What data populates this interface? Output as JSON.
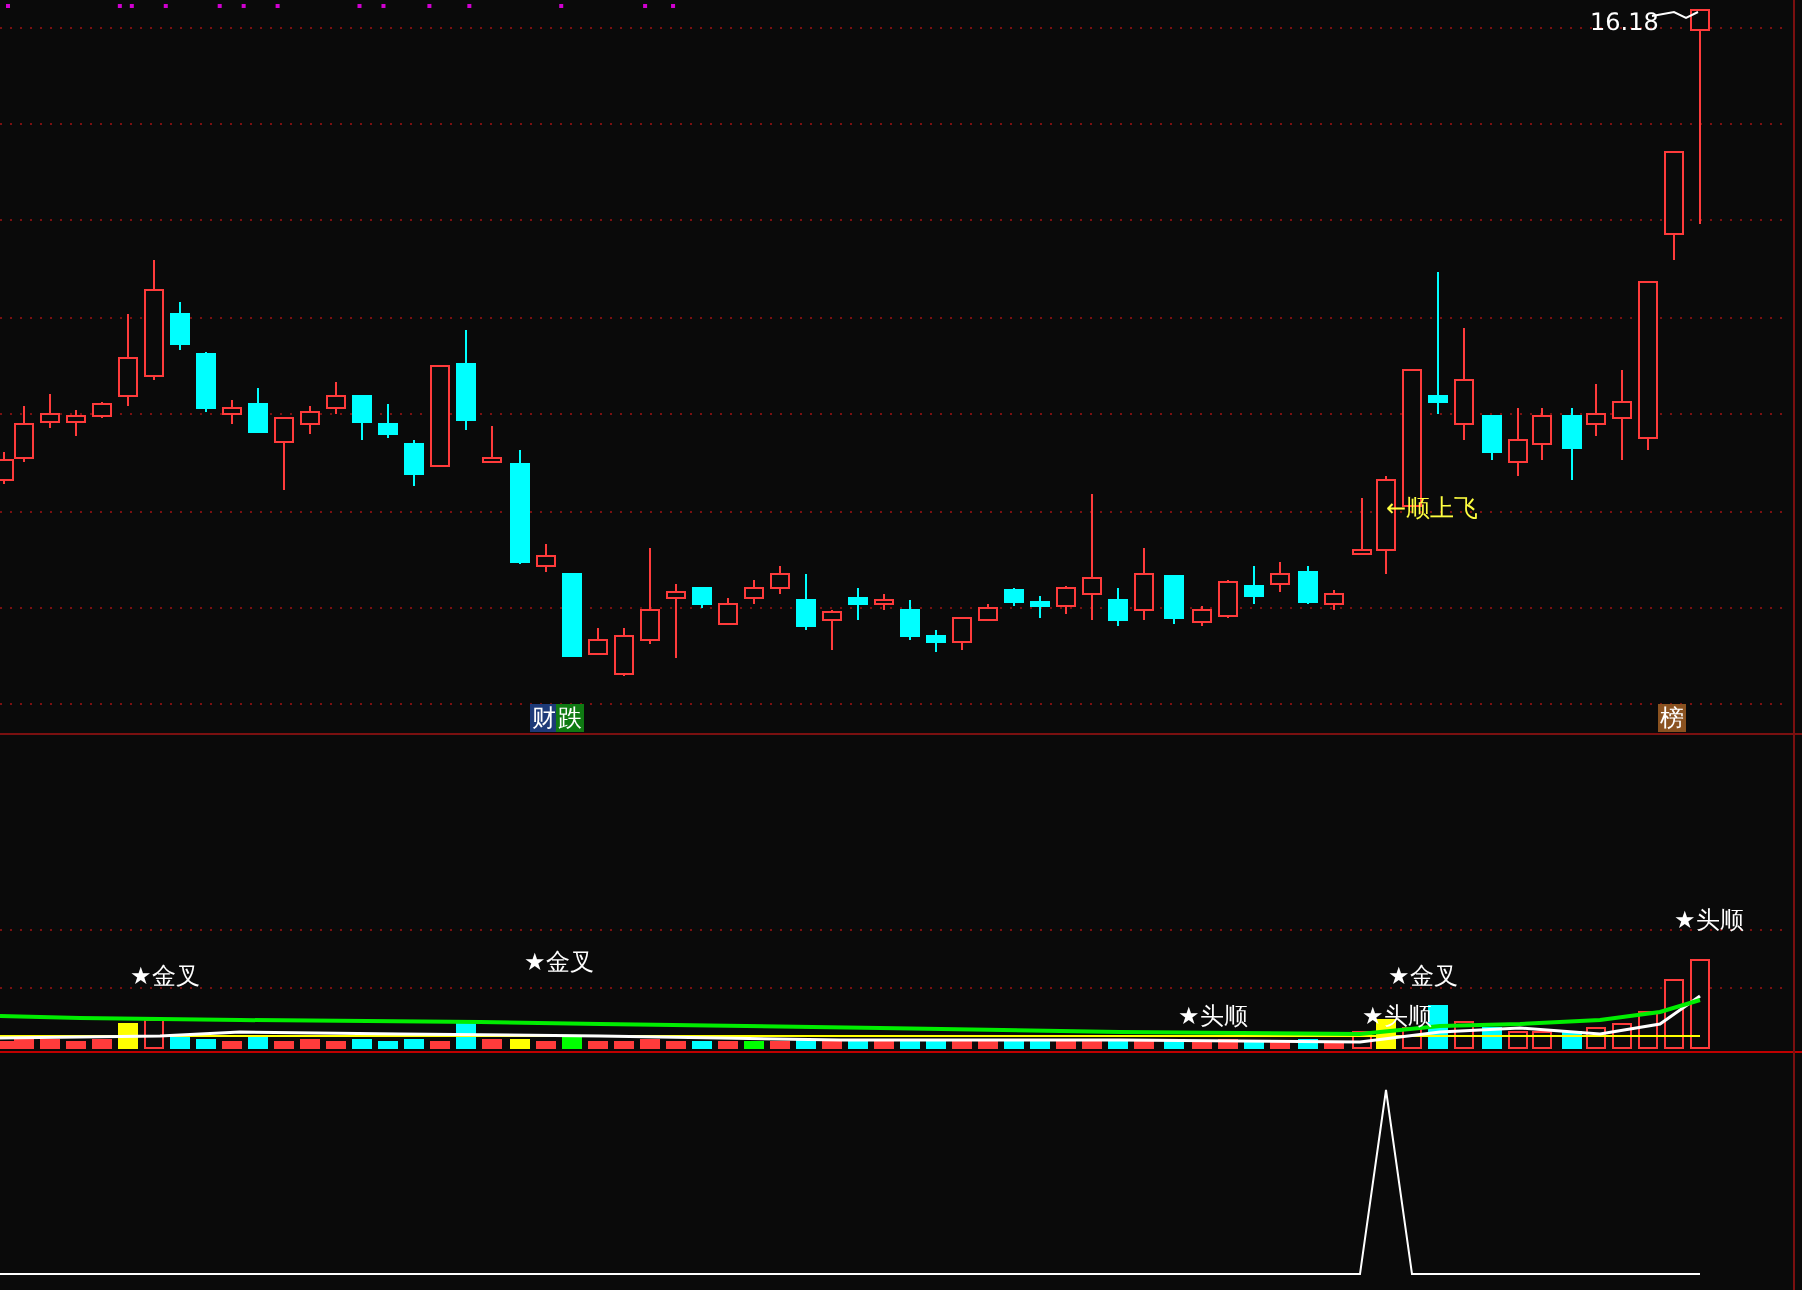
{
  "price_panel": {
    "high_label": "16.18",
    "signals": [
      {
        "text": "←顺上飞"
      }
    ],
    "badges": [
      {
        "text": "财",
        "color": "#1d3a78"
      },
      {
        "text": "跌",
        "color": "#0f7a12"
      },
      {
        "text": "榜",
        "color": "#8a5220"
      }
    ]
  },
  "indicator_panel": {
    "signals": [
      {
        "text": "★金叉"
      },
      {
        "text": "★金叉"
      },
      {
        "text": "★头顺"
      },
      {
        "text": "★头顺"
      },
      {
        "text": "★金叉"
      },
      {
        "text": "★头顺"
      }
    ]
  }
}
